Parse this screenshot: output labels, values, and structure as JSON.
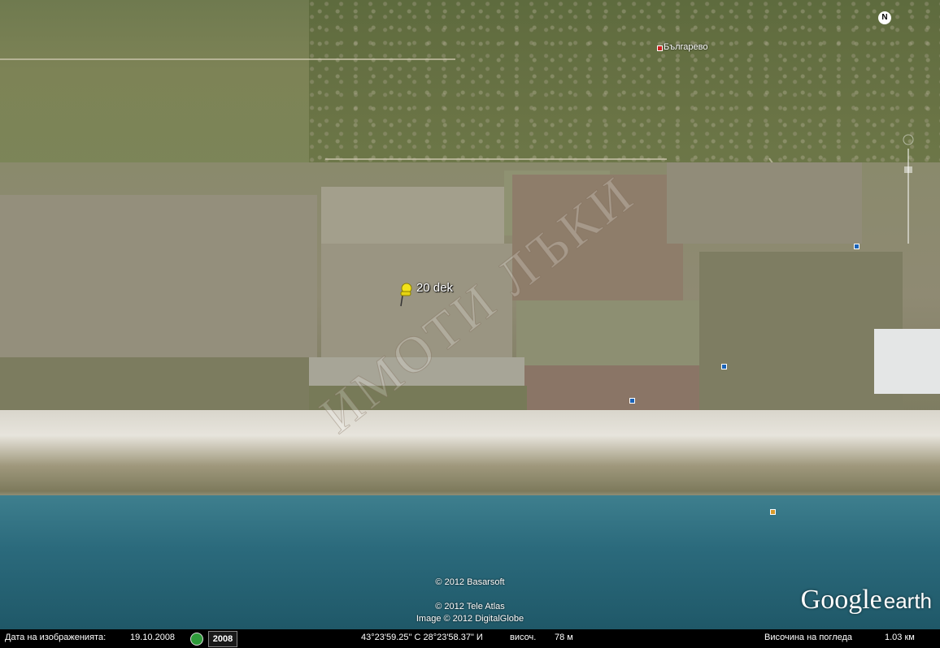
{
  "map": {
    "placemark_label": "20 dek",
    "town_label": "Българево",
    "watermark": "ИМОТИ ЛЪКИ",
    "compass_label": "N"
  },
  "copyright": {
    "line1": "© 2012 Basarsoft",
    "line2": "© 2012 Tele Atlas",
    "line3": "Image © 2012 DigitalGlobe"
  },
  "logo": {
    "brand": "Google",
    "product": "earth"
  },
  "statusbar": {
    "image_date_label": "Дата на изображенията:",
    "image_date_value": "19.10.2008",
    "history_year": "2008",
    "coordinates": "43°23'59.25\" С  28°23'58.37\" И",
    "elevation_label": "височ.",
    "elevation_value": "78 м",
    "eye_alt_label": "Височина на погледа",
    "eye_alt_value": "1.03 км"
  },
  "icons": {
    "placemark": "yellow-pushpin-icon",
    "clock": "historical-imagery-clock-icon",
    "compass": "compass-north-icon",
    "zoom": "zoom-slider-icon"
  },
  "colors": {
    "sea": "#2b6a7c",
    "cliff": "#e7e4dc",
    "pin": "#f2e21a",
    "statusbar": "#000000"
  }
}
